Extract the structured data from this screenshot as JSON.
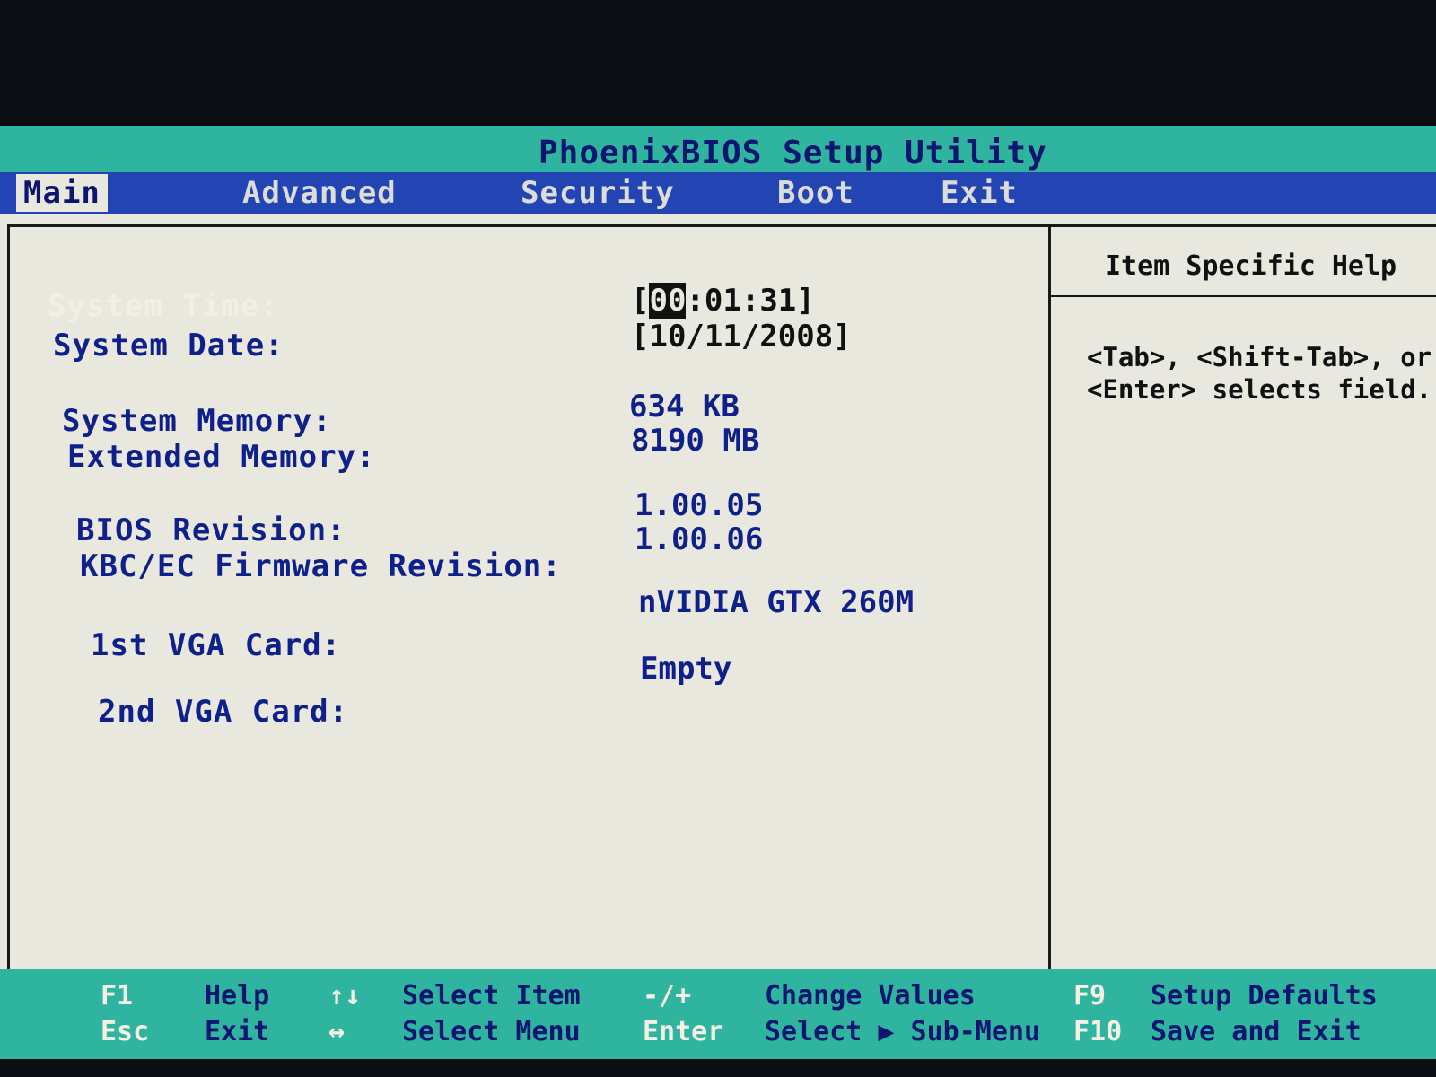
{
  "window": {
    "title": "PhoenixBIOS Setup Utility"
  },
  "menu": {
    "tabs": [
      {
        "label": "Main",
        "active": true
      },
      {
        "label": "Advanced",
        "active": false
      },
      {
        "label": "Security",
        "active": false
      },
      {
        "label": "Boot",
        "active": false
      },
      {
        "label": "Exit",
        "active": false
      }
    ]
  },
  "main": {
    "fields": [
      {
        "label": "System Time:",
        "value_prefix": "[",
        "value_cursor": "00",
        "value_suffix": ":01:31]",
        "selected": true
      },
      {
        "label": "System Date:",
        "value": "[10/11/2008]"
      },
      {
        "label": "System Memory:",
        "value": "634 KB"
      },
      {
        "label": "Extended Memory:",
        "value": "8190 MB"
      },
      {
        "label": "BIOS Revision:",
        "value": "1.00.05"
      },
      {
        "label": "KBC/EC Firmware Revision:",
        "value": "1.00.06"
      },
      {
        "label": "1st VGA Card:",
        "value": "nVIDIA GTX 260M"
      },
      {
        "label": "2nd VGA Card:",
        "value": "Empty"
      }
    ]
  },
  "help": {
    "title": "Item Specific Help",
    "lines": [
      "<Tab>, <Shift-Tab>, or",
      "<Enter> selects field."
    ]
  },
  "footer": {
    "keys": [
      {
        "key": "F1",
        "desc": "Help"
      },
      {
        "key": "Esc",
        "desc": "Exit"
      },
      {
        "key": "↑↓",
        "desc": "Select Item"
      },
      {
        "key": "↔",
        "desc": "Select Menu"
      },
      {
        "key": "-/+",
        "desc": "Change Values"
      },
      {
        "key": "Enter",
        "desc": "Select ▶ Sub-Menu"
      },
      {
        "key": "F9",
        "desc": "Setup Defaults"
      },
      {
        "key": "F10",
        "desc": "Save and Exit"
      }
    ]
  },
  "colors": {
    "title_bar": "#2fb4a0",
    "menu_bar": "#2345b3",
    "panel_bg": "#e9e8df",
    "label_text": "#10208a"
  }
}
